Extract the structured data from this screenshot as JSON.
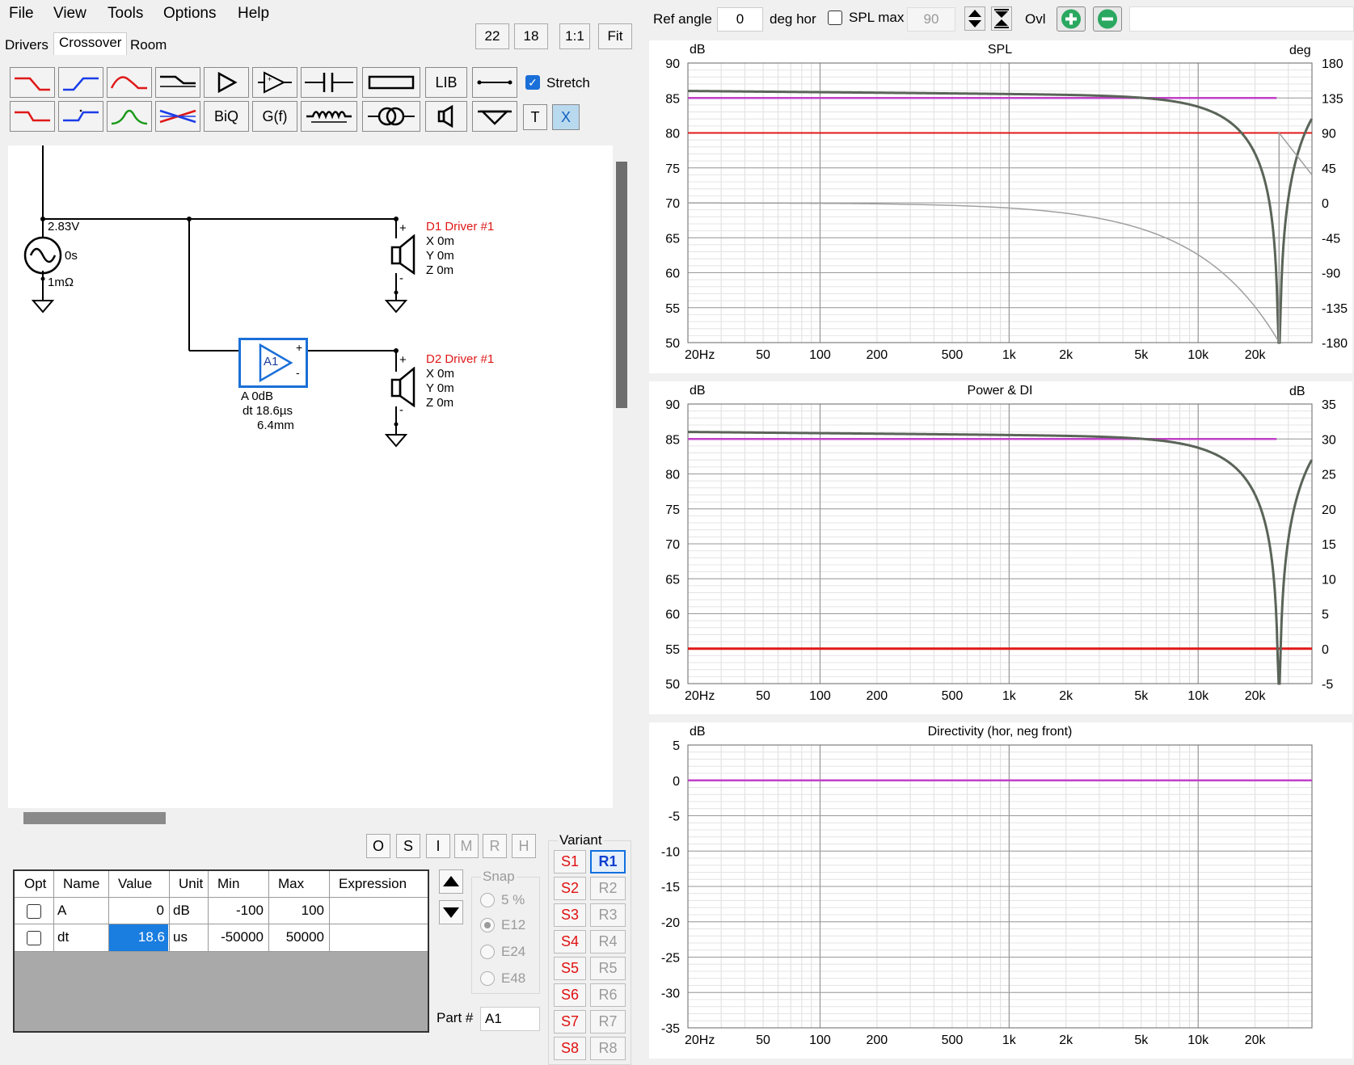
{
  "menu": {
    "file": "File",
    "view": "View",
    "tools": "Tools",
    "options": "Options",
    "help": "Help"
  },
  "tabs": [
    "Drivers",
    "Crossover",
    "Room"
  ],
  "scale_buttons": [
    "22",
    "18",
    "1:1",
    "Fit"
  ],
  "toolbar": {
    "lib": "LIB",
    "biq": "BiQ",
    "gf": "G(f)",
    "t": "T",
    "x": "X",
    "stretch": "Stretch",
    "stretch_checked": true
  },
  "schematic": {
    "source": {
      "voltage": "2.83V",
      "delay": "0s",
      "resistance": "1mΩ"
    },
    "amp": {
      "label": "A1",
      "gain": "A  0dB",
      "dt": "dt 18.6µs",
      "dist": "6.4mm",
      "plus": "+",
      "minus": "-"
    },
    "driver1": {
      "name": "D1 Driver #1",
      "x": "X 0m",
      "y": "Y 0m",
      "z": "Z 0m"
    },
    "driver2": {
      "name": "D2 Driver #1",
      "x": "X 0m",
      "y": "Y 0m",
      "z": "Z 0m"
    }
  },
  "opt_buttons": [
    {
      "label": "O",
      "enabled": true
    },
    {
      "label": "S",
      "enabled": true
    },
    {
      "label": "I",
      "enabled": true
    },
    {
      "label": "M",
      "enabled": false
    },
    {
      "label": "R",
      "enabled": false
    },
    {
      "label": "H",
      "enabled": false
    }
  ],
  "params_table": {
    "headers": [
      "Opt",
      "Name",
      "Value",
      "Unit",
      "Min",
      "Max",
      "Expression"
    ],
    "rows": [
      {
        "name": "A",
        "value": "0",
        "unit": "dB",
        "min": "-100",
        "max": "100",
        "expression": ""
      },
      {
        "name": "dt",
        "value": "18.6",
        "unit": "us",
        "min": "-50000",
        "max": "50000",
        "expression": ""
      }
    ]
  },
  "snap": {
    "label": "Snap",
    "options": [
      "5 %",
      "E12",
      "E24",
      "E48"
    ],
    "selected": "E12"
  },
  "part": {
    "label": "Part #",
    "value": "A1"
  },
  "variant": {
    "label": "Variant",
    "s": [
      "S1",
      "S2",
      "S3",
      "S4",
      "S5",
      "S6",
      "S7",
      "S8"
    ],
    "r": [
      "R1",
      "R2",
      "R3",
      "R4",
      "R5",
      "R6",
      "R7",
      "R8"
    ],
    "active": "R1"
  },
  "topbar": {
    "ref_angle_label": "Ref angle",
    "ref_angle_value": "0",
    "deg_hor": "deg hor",
    "spl_max_label": "SPL max",
    "spl_max_value": "90",
    "ovl": "Ovl"
  },
  "colors": {
    "red": "#e01818",
    "magenta": "#c040c8",
    "dark": "#5a6458",
    "gray": "#9a9a9a",
    "accent": "#1070e0"
  },
  "chart_data": [
    {
      "type": "line",
      "title": "SPL",
      "ylabel_left": "dB",
      "ylabel_right": "deg",
      "x_ticks": [
        "20Hz",
        "50",
        "100",
        "200",
        "500",
        "1k",
        "2k",
        "5k",
        "10k",
        "20k"
      ],
      "y_ticks_left": [
        "90",
        "85",
        "80",
        "75",
        "70",
        "65",
        "60",
        "55",
        "50"
      ],
      "y_ticks_right": [
        "180",
        "135",
        "90",
        "45",
        "0",
        "-45",
        "-90",
        "-135",
        "-180"
      ],
      "ylim": [
        50,
        90
      ],
      "ylim_right": [
        -180,
        180
      ],
      "xlim": [
        20,
        40000
      ],
      "xscale": "log"
    },
    {
      "type": "line",
      "title": "Power & DI",
      "ylabel_left": "dB",
      "ylabel_right": "dB",
      "x_ticks": [
        "20Hz",
        "50",
        "100",
        "200",
        "500",
        "1k",
        "2k",
        "5k",
        "10k",
        "20k"
      ],
      "y_ticks_left": [
        "90",
        "85",
        "80",
        "75",
        "70",
        "65",
        "60",
        "55",
        "50"
      ],
      "y_ticks_right": [
        "35",
        "30",
        "25",
        "20",
        "15",
        "10",
        "5",
        "0",
        "-5"
      ],
      "ylim": [
        50,
        90
      ],
      "ylim_right": [
        -5,
        35
      ],
      "xlim": [
        20,
        40000
      ],
      "xscale": "log"
    },
    {
      "type": "line",
      "title": "Directivity (hor, neg front)",
      "ylabel_left": "dB",
      "x_ticks": [
        "20Hz",
        "50",
        "100",
        "200",
        "500",
        "1k",
        "2k",
        "5k",
        "10k",
        "20k"
      ],
      "y_ticks_left": [
        "5",
        "0",
        "-5",
        "-10",
        "-15",
        "-20",
        "-25",
        "-30",
        "-35"
      ],
      "ylim": [
        -35,
        5
      ],
      "xlim": [
        20,
        40000
      ],
      "xscale": "log"
    }
  ]
}
